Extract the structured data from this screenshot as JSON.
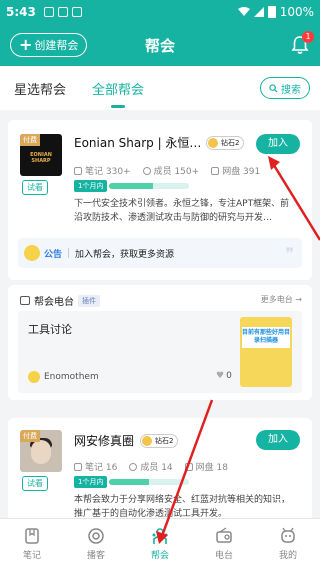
{
  "status": {
    "time": "5:43",
    "battery": "100%"
  },
  "header": {
    "create_label": "创建帮会",
    "title": "帮会",
    "bell_count": "1"
  },
  "tabs": [
    {
      "label": "星选帮会"
    },
    {
      "label": "全部帮会"
    }
  ],
  "search_label": "搜索",
  "card1": {
    "paid": "付费",
    "cover_text": "EONIAN SHARP",
    "trial": "试看",
    "name": "Eonian Sharp | 永恒…",
    "badge": "钻石2",
    "join": "加入",
    "notes": "笔记 330+",
    "members": "成员 150+",
    "disk": "网盘 391",
    "progress_label": "1个月内",
    "progress": 0.55,
    "desc": "下一代安全技术引领者。永恒之锋，专注APT框架、前沿攻防技术、渗透测试攻击与防御的研究与开发…",
    "notice_tag": "公告",
    "notice_text": "加入帮会，获取更多资源"
  },
  "radio": {
    "title": "帮会电台",
    "plugin": "插件",
    "more": "更多电台 →",
    "item_title": "工具讨论",
    "author": "Enomothem",
    "likes": "0",
    "thumb_text": "目前有那些好用目录扫描器"
  },
  "card3": {
    "paid": "付费",
    "trial": "试看",
    "name": "网安修真圈",
    "badge": "钻石2",
    "join": "加入",
    "notes": "笔记 16",
    "members": "成员 14",
    "disk": "网盘 18",
    "progress_label": "1个月内",
    "progress": 0.5,
    "desc": "本帮会致力于分享网络安全、红蓝对抗等相关的知识，推广基于的自动化渗透测试工具开发。"
  },
  "nav": [
    {
      "label": "笔记"
    },
    {
      "label": "播客"
    },
    {
      "label": "帮会"
    },
    {
      "label": "电台"
    },
    {
      "label": "我的"
    }
  ],
  "colors": {
    "accent": "#16b3a3",
    "arrow": "#e02020"
  }
}
